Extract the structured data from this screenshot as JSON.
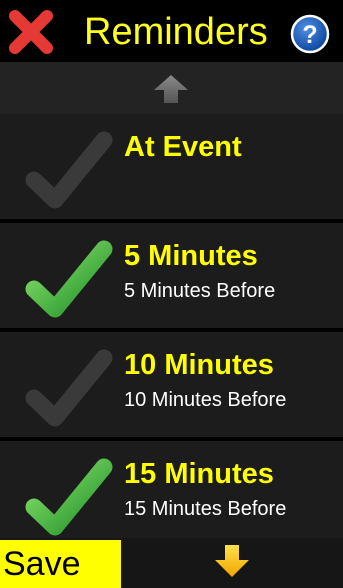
{
  "header": {
    "title": "Reminders",
    "close_icon": "close-x-icon",
    "help_icon": "help-question-icon"
  },
  "scroll": {
    "up_icon": "arrow-up-icon",
    "down_icon": "arrow-down-icon"
  },
  "reminders": [
    {
      "label": "At Event",
      "detail": "",
      "checked": false
    },
    {
      "label": "5 Minutes",
      "detail": "5 Minutes Before",
      "checked": true
    },
    {
      "label": "10 Minutes",
      "detail": "10 Minutes Before",
      "checked": false
    },
    {
      "label": "15 Minutes",
      "detail": "15 Minutes Before",
      "checked": true
    }
  ],
  "footer": {
    "save_label": "Save"
  },
  "colors": {
    "accent_yellow": "#ffff00",
    "check_green": "#3fbf3f",
    "check_inactive": "#3a3a3a",
    "close_red": "#e53935",
    "help_blue": "#1565c0"
  }
}
